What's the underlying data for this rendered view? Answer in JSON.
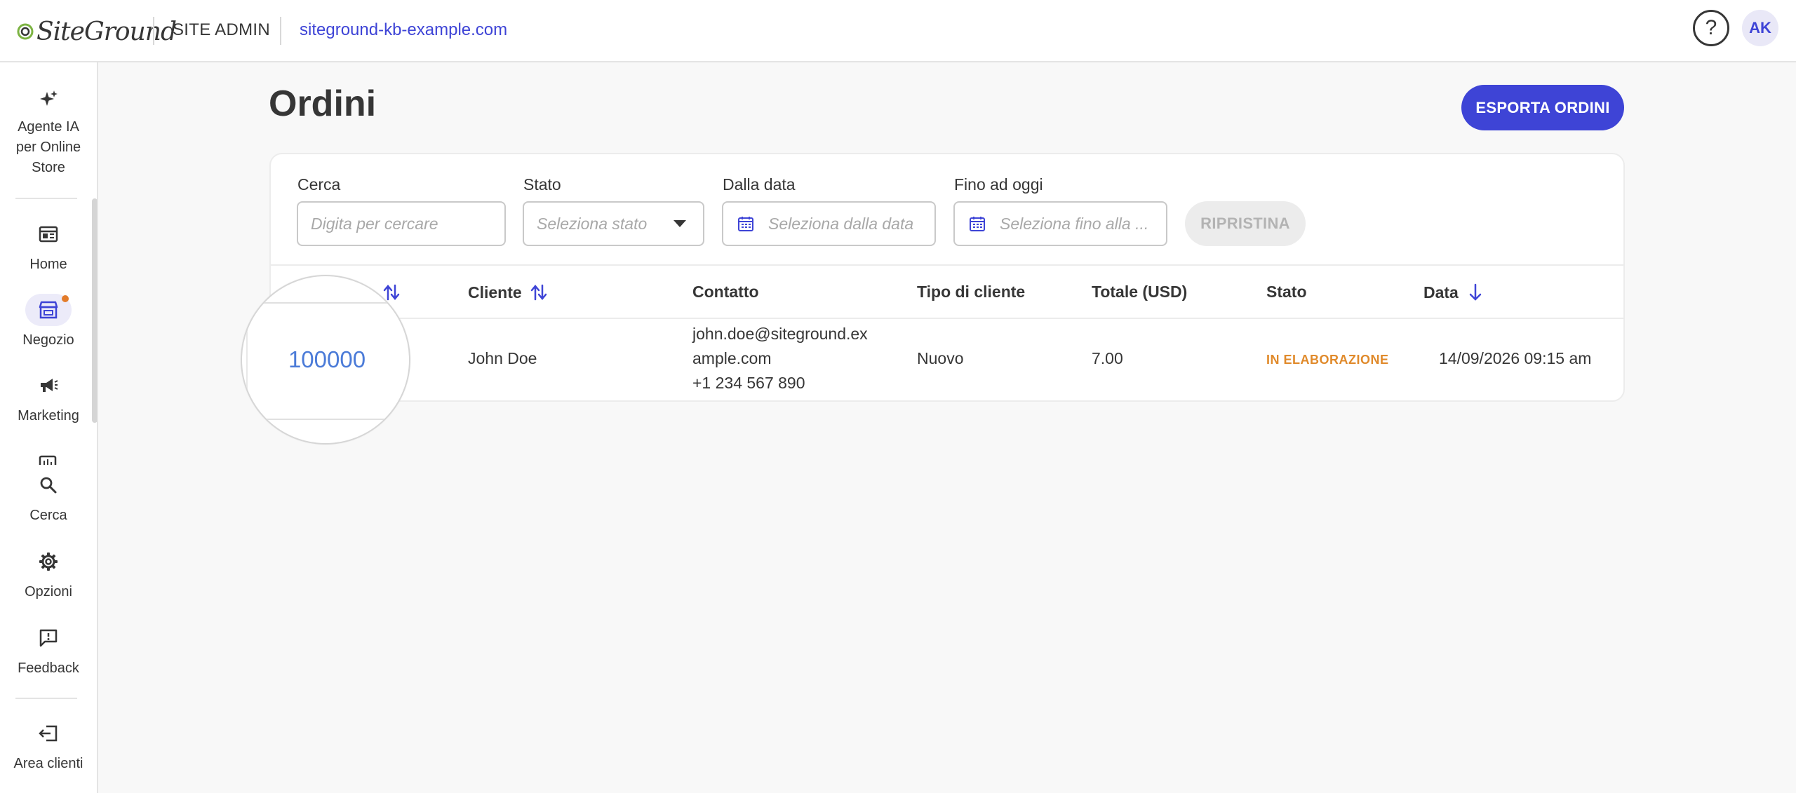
{
  "header": {
    "logo_text": "SiteGround",
    "section": "SITE ADMIN",
    "site_url": "siteground-kb-example.com",
    "help_symbol": "?",
    "avatar_initials": "AK"
  },
  "sidebar": {
    "items": [
      {
        "label": "Agente IA per Online Store",
        "icon": "sparkle-icon"
      },
      {
        "label": "Home",
        "icon": "home-icon"
      },
      {
        "label": "Negozio",
        "icon": "store-icon",
        "active": true
      },
      {
        "label": "Marketing",
        "icon": "megaphone-icon"
      },
      {
        "label": "Cerca",
        "icon": "search-icon"
      },
      {
        "label": "Opzioni",
        "icon": "gear-icon"
      },
      {
        "label": "Feedback",
        "icon": "feedback-icon"
      },
      {
        "label": "Area clienti",
        "icon": "logout-icon"
      }
    ]
  },
  "page": {
    "title": "Ordini",
    "export_label": "ESPORTA ORDINI"
  },
  "filters": {
    "search_label": "Cerca",
    "search_placeholder": "Digita per cercare",
    "status_label": "Stato",
    "status_placeholder": "Seleziona stato",
    "from_label": "Dalla data",
    "from_placeholder": "Seleziona dalla data",
    "to_label": "Fino ad oggi",
    "to_placeholder": "Seleziona fino alla ...",
    "reset_label": "RIPRISTINA"
  },
  "table": {
    "columns": [
      "Cliente",
      "Contatto",
      "Tipo di cliente",
      "Totale (USD)",
      "Stato",
      "Data"
    ],
    "rows": [
      {
        "id": "100000",
        "customer": "John Doe",
        "contact_email_1": "john.doe@siteground.ex",
        "contact_email_2": "ample.com",
        "contact_phone": "+1 234 567 890",
        "customer_type": "Nuovo",
        "total": "7.00",
        "status": "IN ELABORAZIONE",
        "date": "14/09/2026 09:15 am"
      }
    ]
  },
  "colors": {
    "accent": "#3e44d6",
    "status_processing": "#e08a2b",
    "order_link": "#4b7bd8",
    "notification_dot": "#e37c2b"
  }
}
